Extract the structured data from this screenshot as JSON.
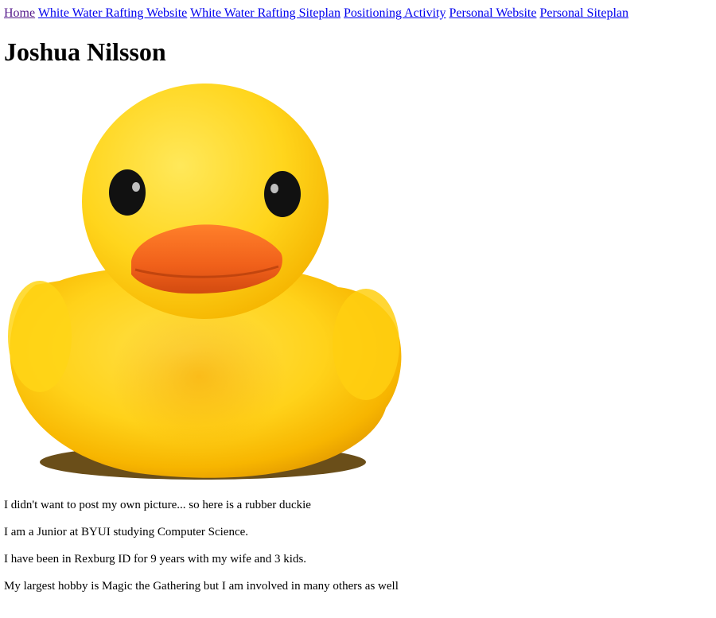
{
  "nav": {
    "links": [
      {
        "label": "Home"
      },
      {
        "label": "White Water Rafting Website"
      },
      {
        "label": "White Water Rafting Siteplan"
      },
      {
        "label": "Positioning Activity"
      },
      {
        "label": "Personal Website"
      },
      {
        "label": "Personal Siteplan"
      }
    ]
  },
  "header": {
    "title": "Joshua Nilsson"
  },
  "image": {
    "subject": "rubber-duck"
  },
  "content": {
    "paragraphs": [
      "I didn't want to post my own picture... so here is a rubber duckie",
      "I am a Junior at BYUI studying Computer Science.",
      "I have been in Rexburg ID for 9 years with my wife and 3 kids.",
      "My largest hobby is Magic the Gathering but I am involved in many others as well"
    ]
  },
  "colors": {
    "link": "#0000ee",
    "visited_link": "#551a8b",
    "duck_body": "#ffd21a",
    "duck_beak": "#f26a1b"
  }
}
